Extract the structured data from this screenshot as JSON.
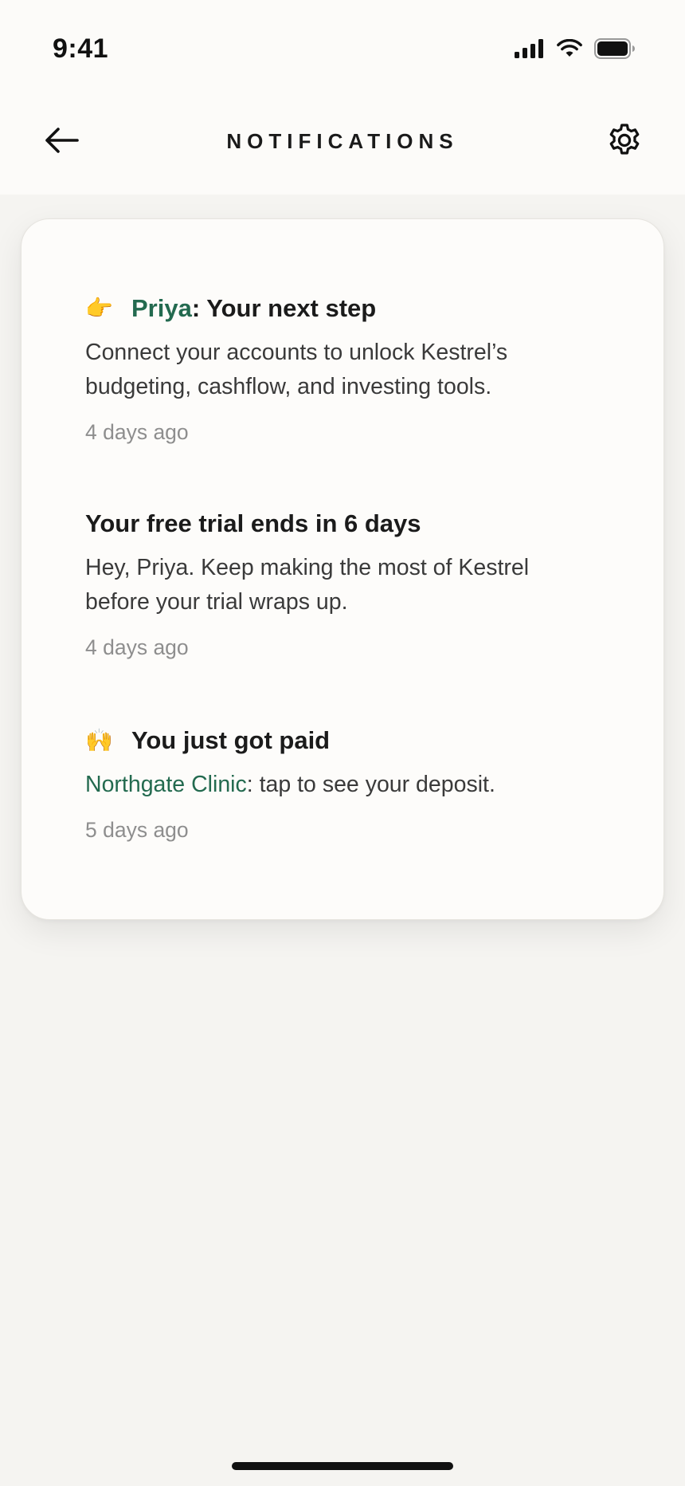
{
  "status_bar": {
    "time": "9:41",
    "signal_icon": "cellular-signal-icon",
    "wifi_icon": "wifi-icon",
    "battery_icon": "battery-icon"
  },
  "nav": {
    "back_icon": "arrow-left-icon",
    "title": "NOTIFICATIONS",
    "settings_icon": "gear-icon"
  },
  "colors": {
    "accent_green": "#236a4f",
    "background": "#f5f4f1",
    "card": "#fdfcfa",
    "timestamp": "#8e8e8e"
  },
  "notifications": [
    {
      "emoji": "👉",
      "title_highlight": "Priya",
      "title_rest": ": Your next step",
      "body": "Connect your accounts to unlock Kestrel’s budgeting, cashflow, and investing tools.",
      "time": "4 days ago"
    },
    {
      "title": "Your free trial ends in 6 days",
      "body": "Hey, Priya. Keep making the most of Kestrel before your trial wraps up.",
      "time": "4 days ago"
    },
    {
      "emoji": "🙌",
      "title": "You just got paid",
      "body_highlight": "Northgate Clinic",
      "body_rest": ": tap to see your deposit.",
      "time": "5 days ago"
    }
  ]
}
